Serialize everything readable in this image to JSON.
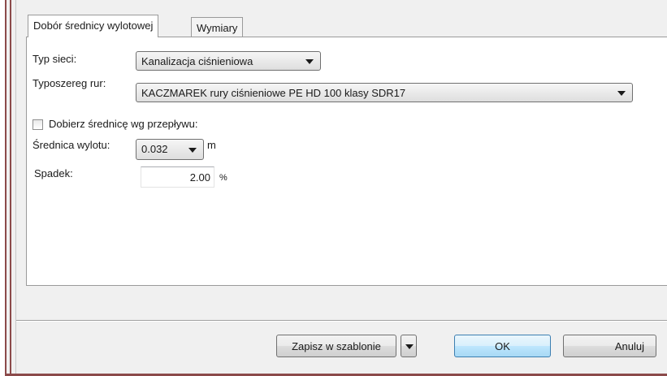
{
  "tabs": {
    "active": "Dobór średnicy wylotowej",
    "second": "Wymiary"
  },
  "form": {
    "network_type_label": "Typ sieci:",
    "network_type_value": "Kanalizacja ciśnieniowa",
    "pipe_series_label": "Typoszereg rur:",
    "pipe_series_value": "KACZMAREK rury ciśnieniowe PE HD 100 klasy SDR17",
    "auto_diameter_label": "Dobierz średnicę wg przepływu:",
    "auto_diameter_checked": false,
    "outlet_diameter_label": "Średnica wylotu:",
    "outlet_diameter_value": "0.032",
    "outlet_diameter_unit": "m",
    "slope_label": "Spadek:",
    "slope_value": "2.00",
    "slope_unit": "%"
  },
  "buttons": {
    "save_template": "Zapisz w szablonie",
    "ok": "OK",
    "cancel": "Anuluj"
  },
  "icons": {
    "dropdown": "chevron-down-icon"
  }
}
